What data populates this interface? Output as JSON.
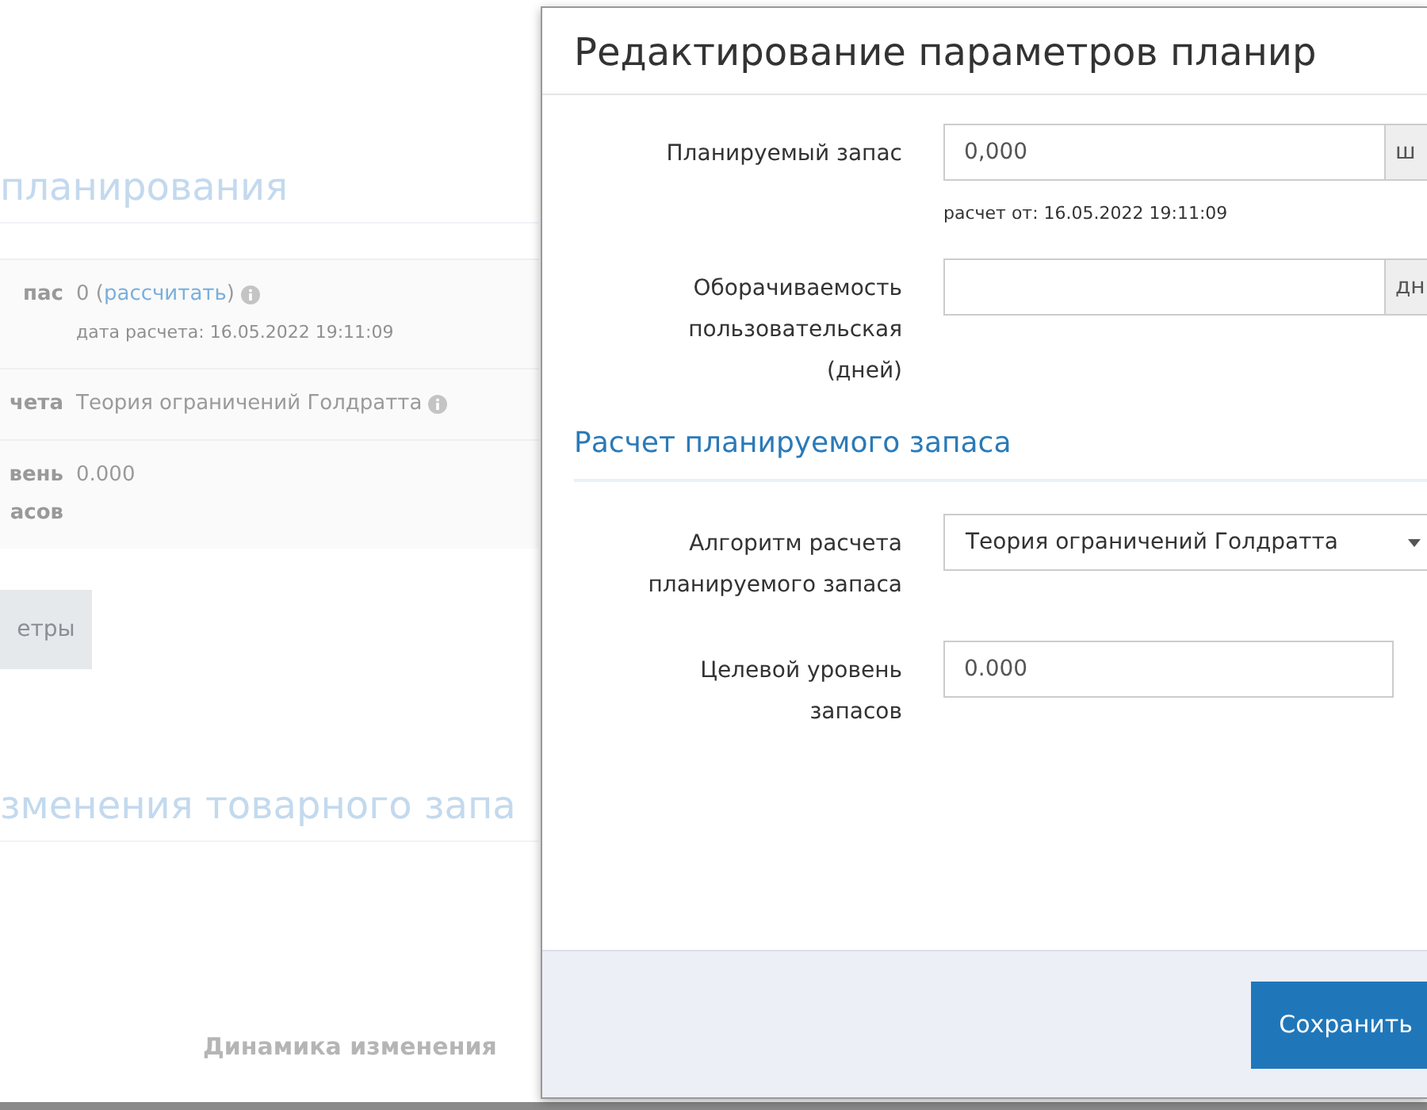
{
  "background": {
    "section_title": "планирования",
    "rows": [
      {
        "label": [
          "пас"
        ],
        "value": "0 (",
        "link": "рассчитать",
        "value_end": ")",
        "info": true,
        "note": "дата расчета: 16.05.2022 19:11:09"
      },
      {
        "label": [
          "чета"
        ],
        "value": "Теория ограничений Голдратта",
        "info": true
      },
      {
        "label": [
          "вень",
          "асов"
        ],
        "value": "0.000",
        "info": false
      }
    ],
    "button": "етры",
    "chart_section_title": "зменения товарного запа",
    "chart_title": "Динамика изменения"
  },
  "modal": {
    "title": "Редактирование параметров планир",
    "fields": [
      {
        "kind": "addon",
        "label": "Планируемый запас",
        "value": "0,000",
        "addon": "ш",
        "note": "расчет от: 16.05.2022 19:11:09"
      },
      {
        "kind": "addon",
        "label": "Оборачиваемость пользовательская (дней)",
        "addon": "дн"
      }
    ],
    "section_title": "Расчет планируемого запаса",
    "fields2": [
      {
        "kind": "select",
        "label": "Алгоритм расчета планируемого запаса",
        "value": "Теория ограничений Голдратта"
      },
      {
        "kind": "text",
        "label": "Целевой уровень запасов",
        "value": "0.000"
      }
    ],
    "save_button": "Сохранить"
  }
}
